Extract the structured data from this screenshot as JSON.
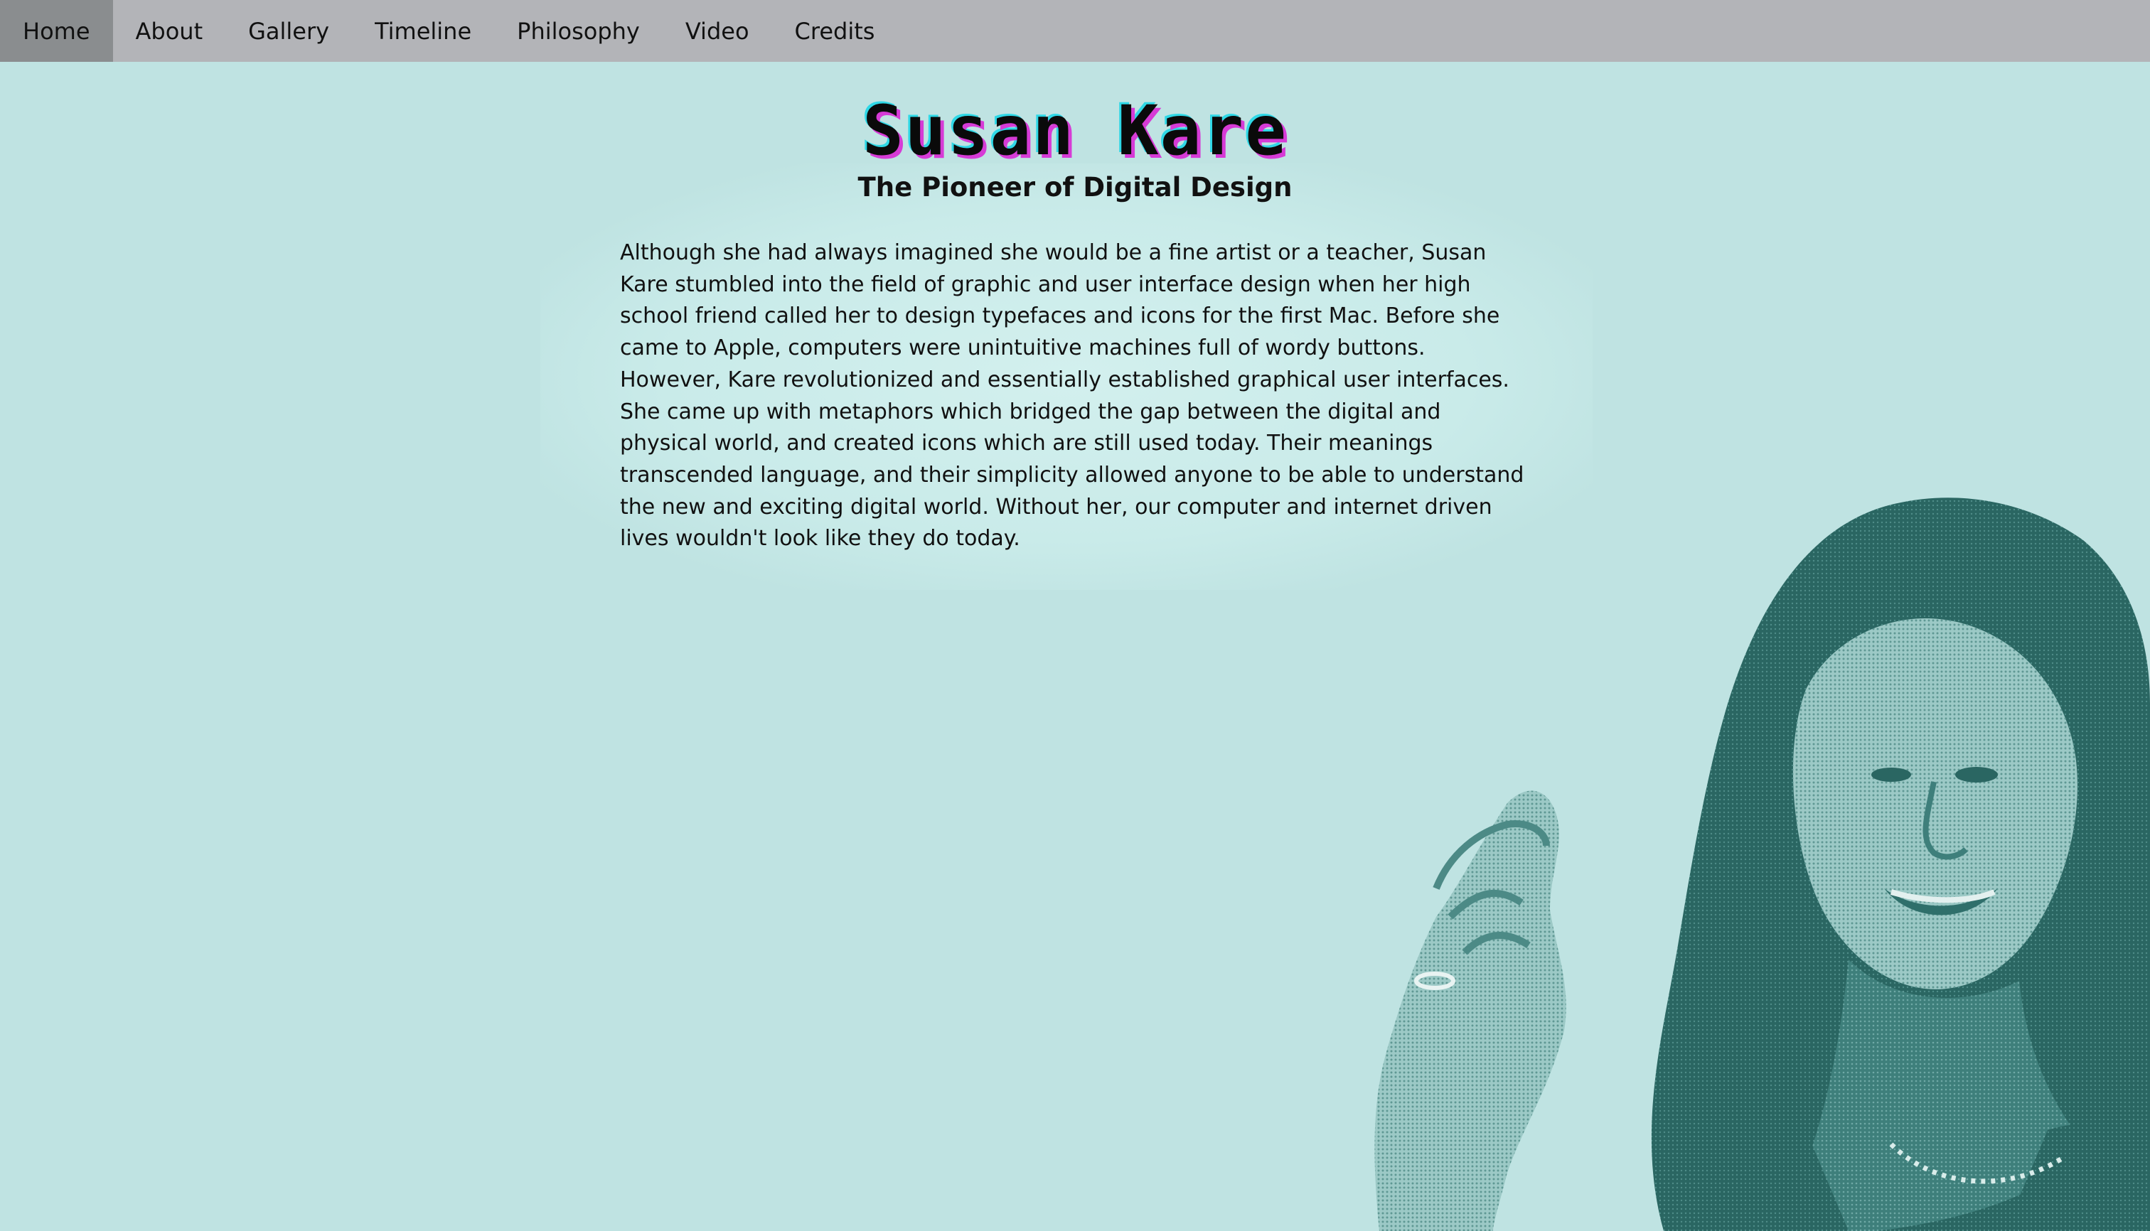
{
  "nav": {
    "items": [
      {
        "label": "Home",
        "active": true
      },
      {
        "label": "About",
        "active": false
      },
      {
        "label": "Gallery",
        "active": false
      },
      {
        "label": "Timeline",
        "active": false
      },
      {
        "label": "Philosophy",
        "active": false
      },
      {
        "label": "Video",
        "active": false
      },
      {
        "label": "Credits",
        "active": false
      }
    ]
  },
  "header": {
    "title": "Susan Kare",
    "subtitle": "The Pioneer of Digital Design"
  },
  "main": {
    "intro": "Although she had always imagined she would be a fine artist or a teacher, Susan Kare stumbled into the field of graphic and user interface design when her high school friend called her to design typefaces and icons for the first Mac. Before she came to Apple, computers were unintuitive machines full of wordy buttons. However, Kare revolutionized and essentially established graphical user interfaces. She came up with metaphors which bridged the gap between the digital and physical world, and created icons which are still used today. Their meanings transcended language, and their simplicity allowed anyone to be able to understand the new and exciting digital world. Without her, our computer and internet driven lives wouldn't look like they do today."
  },
  "colors": {
    "background": "#bfe3e2",
    "navbar": "#b3b4b8",
    "nav_active": "#8a8d8f",
    "portrait": "#2f6f6b",
    "title_shadow_magenta": "#d63bd6",
    "title_shadow_cyan": "#2fd8e6"
  }
}
